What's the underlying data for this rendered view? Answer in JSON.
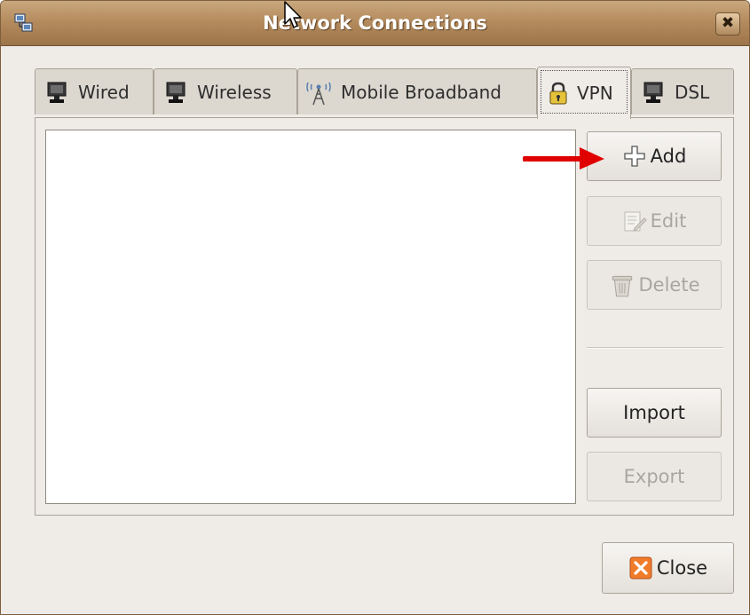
{
  "window": {
    "title": "Network Connections",
    "close_glyph": "✖"
  },
  "tabs": [
    {
      "label": "Wired",
      "icon": "wired-network-icon",
      "active": false
    },
    {
      "label": "Wireless",
      "icon": "wireless-network-icon",
      "active": false
    },
    {
      "label": "Mobile Broadband",
      "icon": "mobile-broadband-antenna-icon",
      "active": false
    },
    {
      "label": "VPN",
      "icon": "vpn-lock-icon",
      "active": true
    },
    {
      "label": "DSL",
      "icon": "dsl-network-icon",
      "active": false
    }
  ],
  "buttons": {
    "add": "Add",
    "edit": "Edit",
    "delete": "Delete",
    "import": "Import",
    "export": "Export",
    "close": "Close"
  },
  "colors": {
    "titlebar": "#b58c5e",
    "annotation_arrow": "#e00000",
    "close_icon": "#f07c2a"
  }
}
